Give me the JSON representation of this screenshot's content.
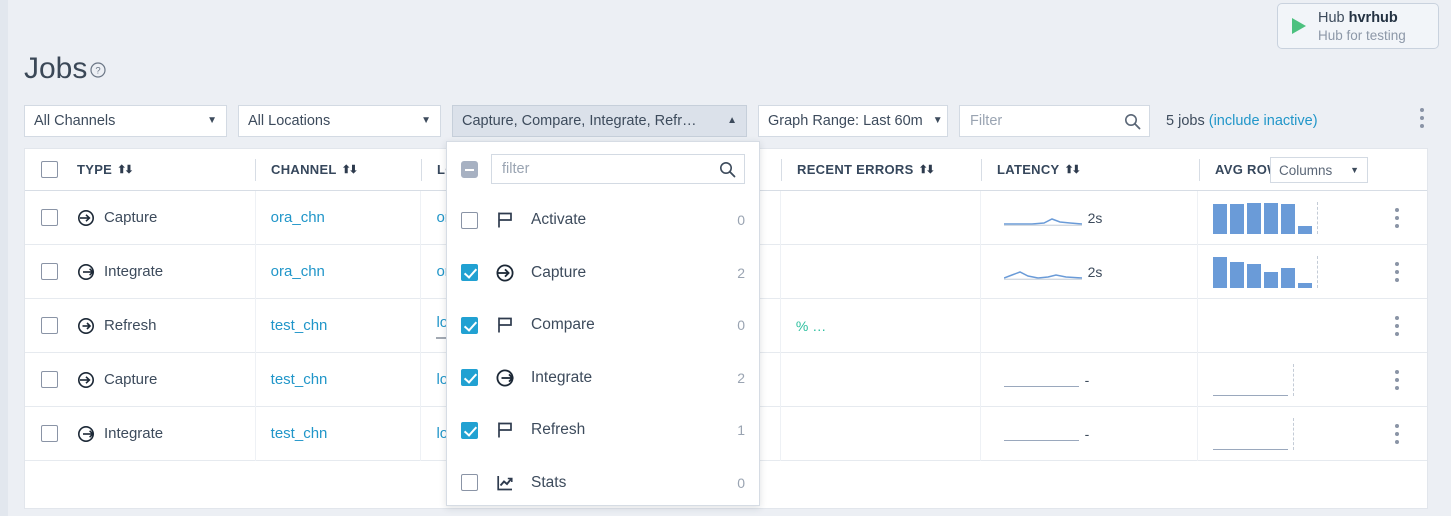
{
  "hub": {
    "play_icon": "play-icon",
    "label_prefix": "Hub ",
    "name": "hvrhub",
    "description": "Hub for testing"
  },
  "page": {
    "title": "Jobs",
    "help_icon": "help-circle-icon"
  },
  "toolbar": {
    "channels": "All Channels",
    "locations": "All Locations",
    "types": "Capture, Compare, Integrate, Refr…",
    "graph_range": "Graph Range: Last 60m",
    "filter_placeholder": "Filter",
    "filter_value": "",
    "search_icon": "search-icon",
    "jobs_count": "5 jobs ",
    "include_inactive": "(include inactive)",
    "overflow_icon": "kebab-menu-icon"
  },
  "table": {
    "columns_button": "Columns",
    "headers": [
      {
        "label": "TYPE",
        "sortable": true
      },
      {
        "label": "CHANNEL",
        "sortable": true
      },
      {
        "label": "LO",
        "sortable": false
      },
      {
        "label": "RECENT ERRORS",
        "sortable": true
      },
      {
        "label": "LATENCY",
        "sortable": true
      },
      {
        "label": "AVG ROWS/",
        "sortable": false
      }
    ],
    "rows": [
      {
        "checked": false,
        "type": "Capture",
        "type_icon": "capture-arrow-icon",
        "channel": "ora_chn",
        "location": "ora",
        "errors": "",
        "latency": "2s",
        "latency_trend": "low-flat",
        "rows_bars": [
          30,
          30,
          31,
          31,
          30,
          8
        ],
        "menu_icon": "kebab-menu-icon"
      },
      {
        "checked": false,
        "type": "Integrate",
        "type_icon": "integrate-arrow-icon",
        "channel": "ora_chn",
        "location": "ora",
        "errors": "",
        "latency": "2s",
        "latency_trend": "bump",
        "rows_bars": [
          31,
          26,
          24,
          16,
          20,
          5
        ],
        "menu_icon": "kebab-menu-icon"
      },
      {
        "checked": false,
        "type": "Refresh",
        "type_icon": "refresh-arrow-icon",
        "channel": "test_chn",
        "location": "loc",
        "errors": "% …",
        "latency": "",
        "latency_trend": "none",
        "rows_bars": [],
        "menu_icon": "kebab-menu-icon"
      },
      {
        "checked": false,
        "type": "Capture",
        "type_icon": "capture-arrow-icon",
        "channel": "test_chn",
        "location": "loc",
        "errors": "",
        "latency": "-",
        "latency_trend": "flat",
        "rows_bars": [],
        "menu_icon": "kebab-menu-icon"
      },
      {
        "checked": false,
        "type": "Integrate",
        "type_icon": "integrate-arrow-icon",
        "channel": "test_chn",
        "location": "loc",
        "errors": "",
        "latency": "-",
        "latency_trend": "flat",
        "rows_bars": [],
        "menu_icon": "kebab-menu-icon"
      }
    ]
  },
  "type_dropdown": {
    "select_all_state": "indeterminate",
    "filter_placeholder": "filter",
    "filter_value": "",
    "search_icon": "search-icon",
    "items": [
      {
        "label": "Activate",
        "icon": "flag-icon",
        "checked": false,
        "count": "0"
      },
      {
        "label": "Capture",
        "icon": "capture-arrow-icon",
        "checked": true,
        "count": "2"
      },
      {
        "label": "Compare",
        "icon": "flag-icon",
        "checked": true,
        "count": "0"
      },
      {
        "label": "Integrate",
        "icon": "integrate-arrow-icon",
        "checked": true,
        "count": "2"
      },
      {
        "label": "Refresh",
        "icon": "flag-icon",
        "checked": true,
        "count": "1"
      },
      {
        "label": "Stats",
        "icon": "chart-line-icon",
        "checked": false,
        "count": "0"
      }
    ]
  },
  "colors": {
    "accent": "#21a1d2",
    "link": "#2196c9",
    "bar": "#6a9bd8",
    "play": "#4cc17f",
    "success": "#2bbf9e",
    "page_bg": "#eceff4"
  }
}
